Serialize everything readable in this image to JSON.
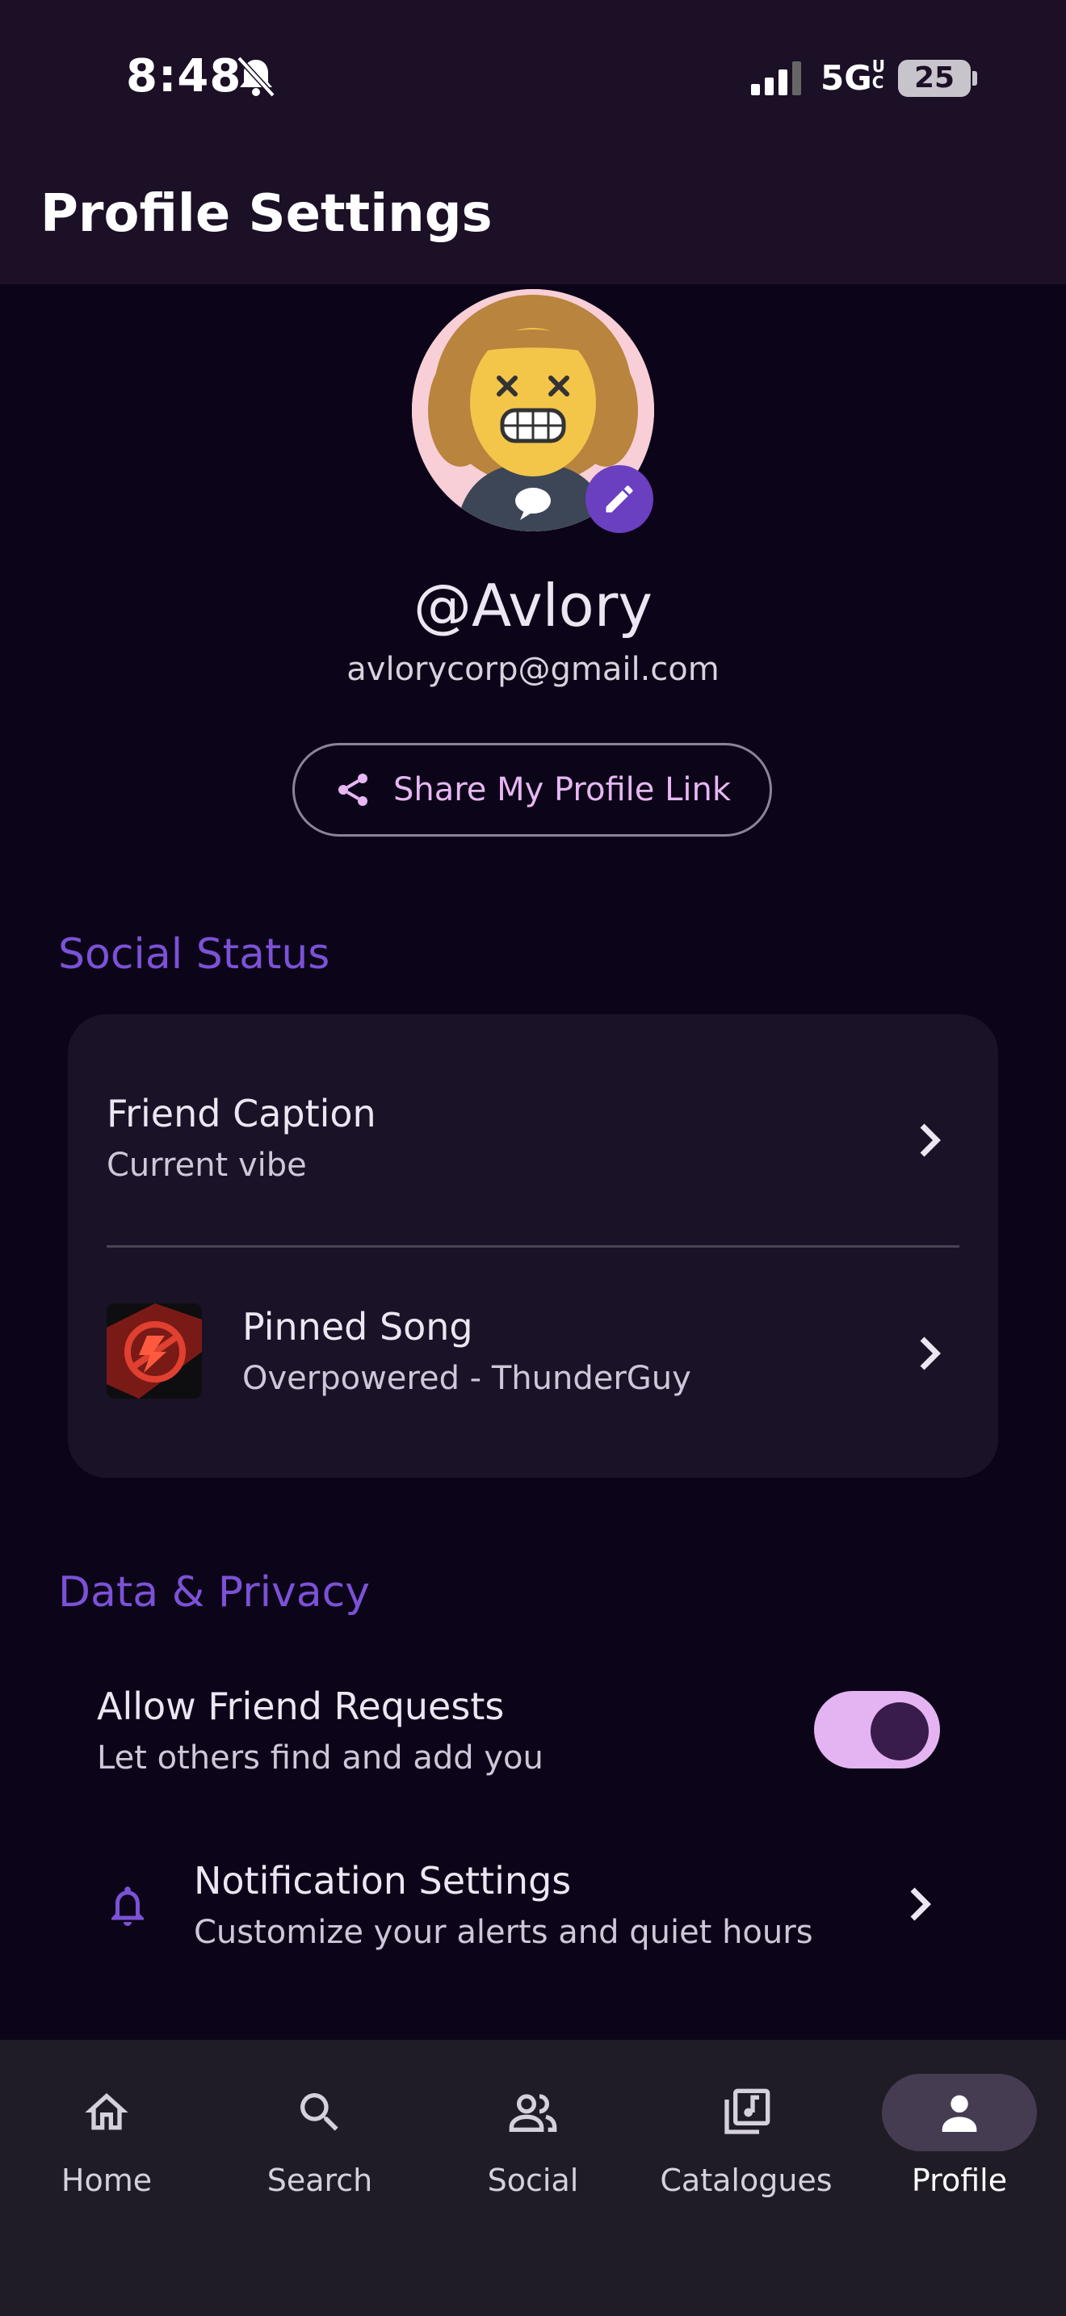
{
  "status_bar": {
    "time": "8:48",
    "network": "5G",
    "network_sup": "UC",
    "battery": "25"
  },
  "header": {
    "title": "Profile Settings"
  },
  "profile": {
    "username": "@Avlory",
    "email": "avlorycorp@gmail.com",
    "share_label": "Share My Profile Link"
  },
  "social_status": {
    "section_title": "Social Status",
    "friend_caption": {
      "title": "Friend Caption",
      "subtitle": "Current vibe"
    },
    "pinned_song": {
      "title": "Pinned Song",
      "subtitle": "Overpowered - ThunderGuy"
    }
  },
  "privacy": {
    "section_title": "Data & Privacy",
    "friend_requests": {
      "title": "Allow Friend Requests",
      "subtitle": "Let others find and add you",
      "enabled": true
    },
    "notifications": {
      "title": "Notification Settings",
      "subtitle": "Customize your alerts and quiet hours"
    }
  },
  "bottom_nav": {
    "items": [
      {
        "label": "Home",
        "icon": "home-icon"
      },
      {
        "label": "Search",
        "icon": "search-icon"
      },
      {
        "label": "Social",
        "icon": "people-icon"
      },
      {
        "label": "Catalogues",
        "icon": "library-music-icon"
      },
      {
        "label": "Profile",
        "icon": "person-icon",
        "active": true
      }
    ]
  },
  "colors": {
    "background": "#0c0418",
    "header": "#1b1026",
    "accent": "#7b52d6",
    "toggle_track": "#e4b4f2",
    "nav_bar": "#201c26"
  }
}
